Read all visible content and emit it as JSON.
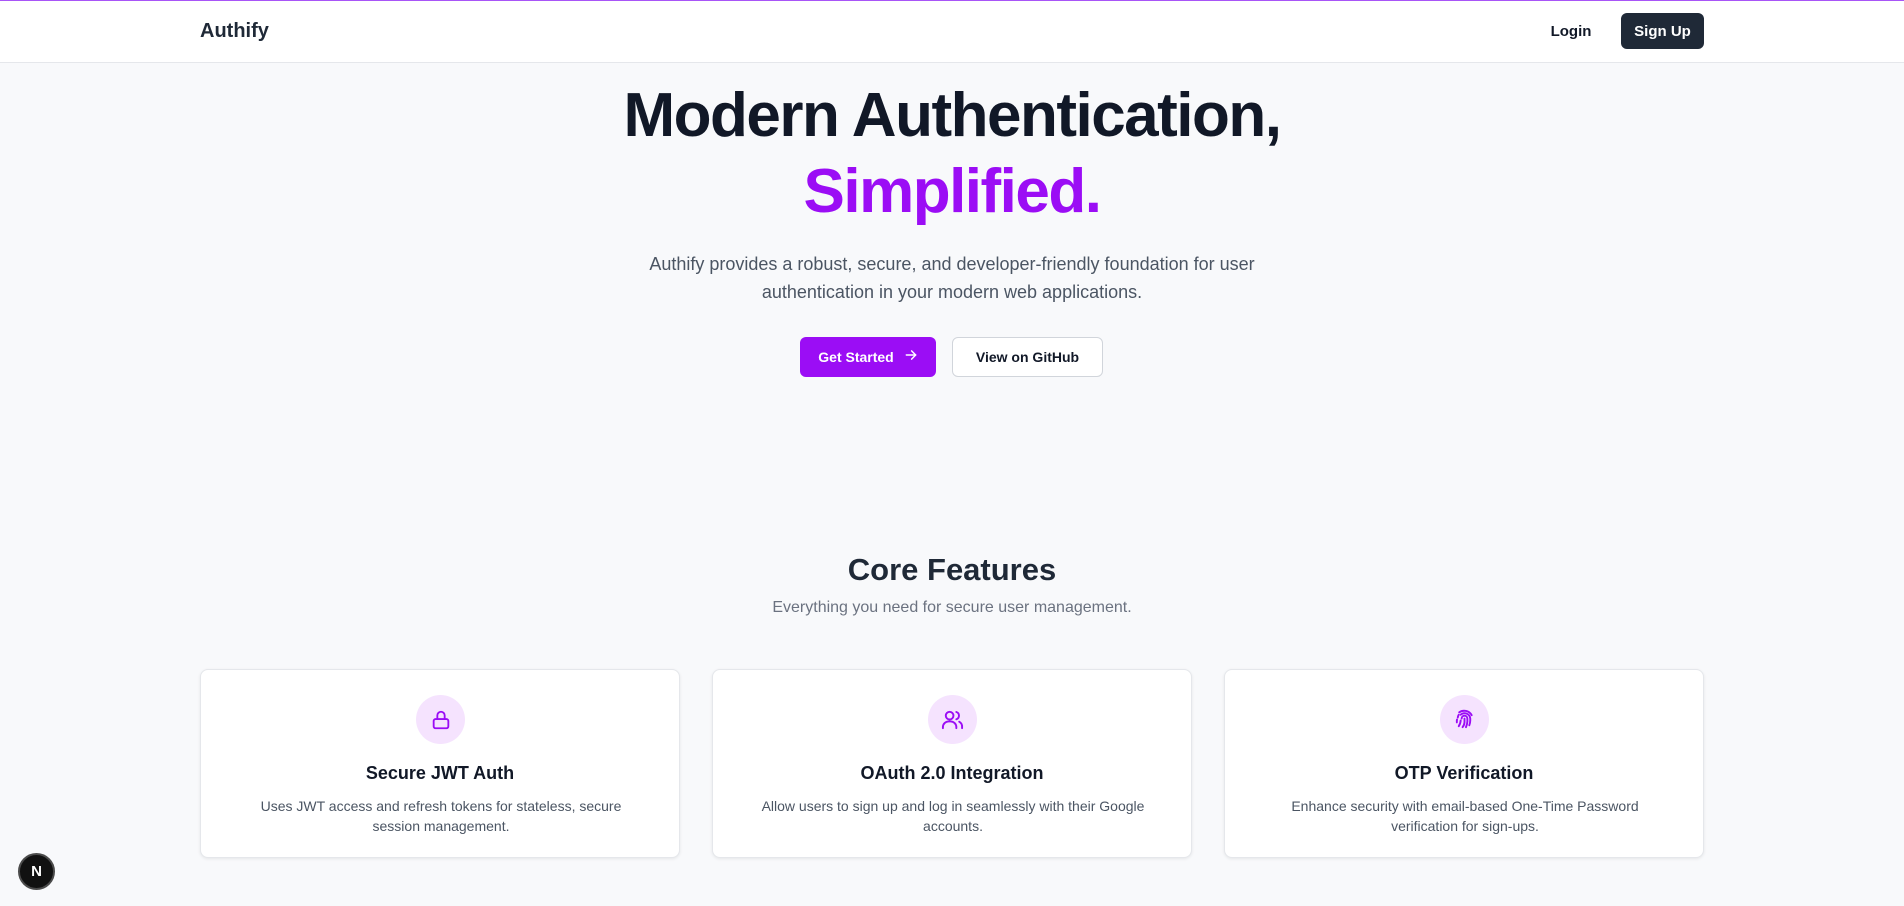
{
  "colors": {
    "accent": "#9b0df5",
    "dark_button": "#1f2937",
    "page_background": "#f8f9fb",
    "icon_circle": "#f5e3fe"
  },
  "navbar": {
    "brand": "Authify",
    "login_label": "Login",
    "signup_label": "Sign Up"
  },
  "hero": {
    "title_line1": "Modern Authentication,",
    "title_line2": "Simplified.",
    "subtitle": "Authify provides a robust, secure, and developer-friendly foundation for user authentication in your modern web applications.",
    "primary_button": "Get Started",
    "primary_button_icon": "arrow-right-icon",
    "secondary_button": "View on GitHub"
  },
  "features": {
    "title": "Core Features",
    "subtitle": "Everything you need for secure user management.",
    "cards": [
      {
        "icon": "lock-icon",
        "title": "Secure JWT Auth",
        "text": "Uses JWT access and refresh tokens for stateless, secure session management."
      },
      {
        "icon": "users-icon",
        "title": "OAuth 2.0 Integration",
        "text": "Allow users to sign up and log in seamlessly with their Google accounts."
      },
      {
        "icon": "fingerprint-icon",
        "title": "OTP Verification",
        "text": "Enhance security with email-based One-Time Password verification for sign-ups."
      }
    ]
  },
  "dev_badge": {
    "label": "N",
    "icon": "nextjs-logo-icon"
  }
}
